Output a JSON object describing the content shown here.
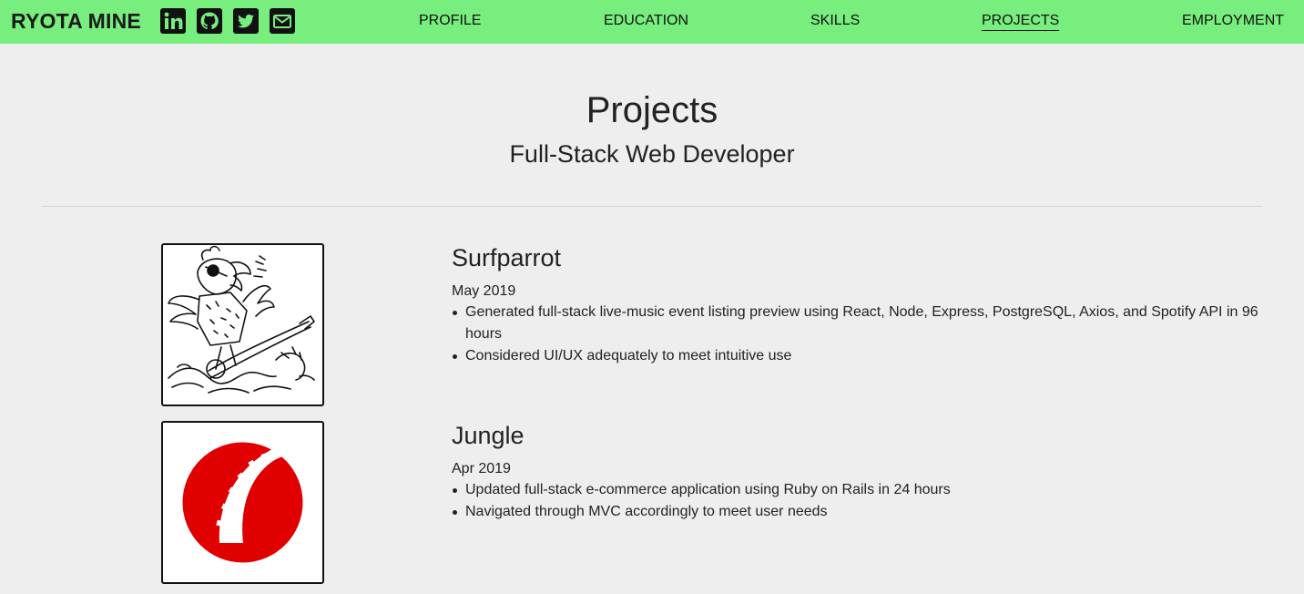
{
  "header": {
    "brand": "RYOTA MINE",
    "social": [
      {
        "icon": "linkedin-icon"
      },
      {
        "icon": "github-icon"
      },
      {
        "icon": "twitter-icon"
      },
      {
        "icon": "email-icon"
      }
    ],
    "nav": [
      {
        "label": "PROFILE"
      },
      {
        "label": "EDUCATION"
      },
      {
        "label": "SKILLS"
      },
      {
        "label": "PROJECTS",
        "active": true
      },
      {
        "label": "EMPLOYMENT"
      }
    ]
  },
  "page": {
    "title": "Projects",
    "subtitle": "Full-Stack Web Developer"
  },
  "projects": [
    {
      "name": "Surfparrot",
      "date": "May 2019",
      "image": "surfing-parrot-logo",
      "bullets": [
        "Generated full-stack live-music event listing preview using React, Node, Express, PostgreSQL, Axios, and Spotify API in 96 hours",
        "Considered UI/UX adequately to meet intuitive use"
      ]
    },
    {
      "name": "Jungle",
      "date": "Apr 2019",
      "image": "ruby-on-rails-logo",
      "bullets": [
        "Updated full-stack e-commerce application using Ruby on Rails in 24 hours",
        "Navigated through MVC accordingly to meet user needs"
      ]
    }
  ],
  "colors": {
    "navbar": "#77ee7d",
    "background": "#eeeeee",
    "rails_red": "#e00000"
  }
}
